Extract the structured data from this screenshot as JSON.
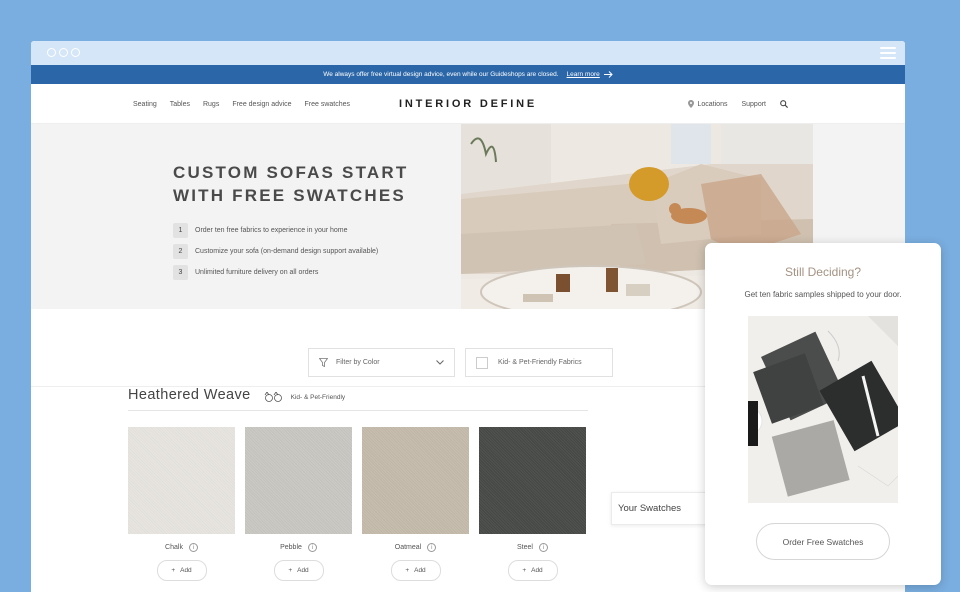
{
  "promo": {
    "text": "We always offer free virtual design advice, even while our Guideshops are closed.",
    "link": "Learn more"
  },
  "nav": {
    "left": [
      "Seating",
      "Tables",
      "Rugs",
      "Free design advice",
      "Free swatches"
    ],
    "logo": "INTERIOR DEFINE",
    "locations": "Locations",
    "support": "Support"
  },
  "hero": {
    "title_line1": "CUSTOM SOFAS START",
    "title_line2": "WITH FREE SWATCHES",
    "steps": [
      {
        "num": "1",
        "text": "Order ten free fabrics to experience in your home"
      },
      {
        "num": "2",
        "text": "Customize your sofa (on-demand design support available)"
      },
      {
        "num": "3",
        "text": "Unlimited furniture delivery on all orders"
      }
    ]
  },
  "filters": {
    "color": "Filter by Color",
    "pet": "Kid- & Pet-Friendly Fabrics"
  },
  "section": {
    "title": "Heathered Weave",
    "tag": "Kid- & Pet-Friendly"
  },
  "swatches": [
    {
      "name": "Chalk",
      "color": "#e6e3de",
      "add": "Add"
    },
    {
      "name": "Pebble",
      "color": "#c9c8c3",
      "add": "Add"
    },
    {
      "name": "Oatmeal",
      "color": "#c6bcae",
      "add": "Add"
    },
    {
      "name": "Steel",
      "color": "#4d4f4d",
      "add": "Add"
    }
  ],
  "your_swatches": "Your Swatches",
  "popup": {
    "title": "Still Deciding?",
    "subtitle": "Get ten fabric samples shipped to your door.",
    "button": "Order Free Swatches"
  },
  "colors": {
    "page_bg": "#7aaee0",
    "promo_bar": "#2b67a8",
    "chrome": "#d4e6f7",
    "popup_title": "#a49282"
  }
}
